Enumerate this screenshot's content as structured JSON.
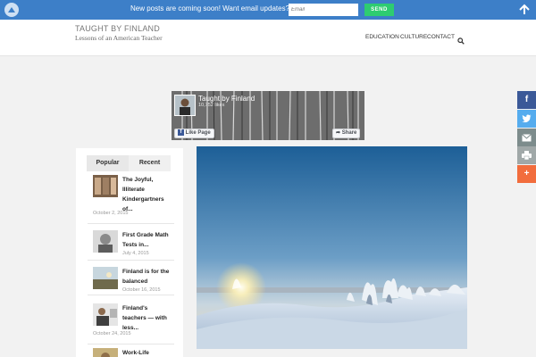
{
  "topbar": {
    "message": "New posts are coming soon! Want email updates?",
    "email_placeholder": "Email",
    "send_label": "SEND"
  },
  "header": {
    "site_title": "TAUGHT BY FINLAND",
    "tagline": "Lessons of an American Teacher",
    "nav": [
      "EDUCATION",
      "CULTURE",
      "CONTACT"
    ]
  },
  "facebook": {
    "page_name": "Taught by Finland",
    "likes": "10,752 likes",
    "like_page": "Like Page",
    "share": "Share"
  },
  "sidebar": {
    "tabs": [
      "Popular",
      "Recent"
    ],
    "posts": [
      {
        "title": "The Joyful, Illiterate Kindergartners of...",
        "date": "October 2, 2015"
      },
      {
        "title": "First Grade Math Tests in...",
        "date": "July 4, 2015"
      },
      {
        "title": "Finland is for the balanced",
        "date": "October 16, 2015"
      },
      {
        "title": "Finland's teachers — with less...",
        "date": "October 24, 2015"
      },
      {
        "title": "Work-Life",
        "date": ""
      }
    ]
  },
  "share_bar": {
    "facebook_icon": "f",
    "more_icon": "+"
  },
  "colors": {
    "topbar": "#3d7fc8",
    "send": "#2ecc71",
    "facebook": "#3b5998",
    "twitter": "#55acee",
    "email": "#7d8c8c",
    "print": "#a0a8a8",
    "more": "#f26d3d"
  }
}
